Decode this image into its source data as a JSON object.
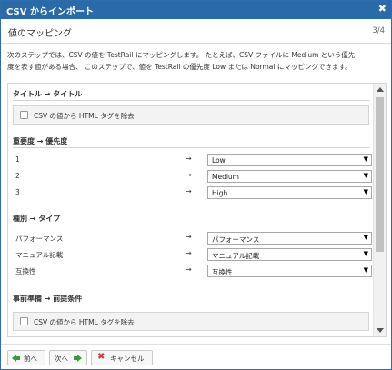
{
  "titlebar": {
    "title": "CSV からインポート",
    "close_glyph": "✖"
  },
  "header": {
    "title": "値のマッピング",
    "step": "3/4"
  },
  "intro": {
    "line1": "次のステップでは、CSV の値を TestRail にマッピングします。 たとえば、CSV ファイルに Medium という優先",
    "line2": "度を表す値がある場合、 このステップで、値を TestRail の優先度 Low または Normal にマッピングできます。"
  },
  "sections": {
    "title": {
      "heading": "タイトル → タイトル",
      "checkbox_label": "CSV の値から HTML タグを除去"
    },
    "priority": {
      "heading": "重要度 → 優先度",
      "rows": [
        {
          "key": "1",
          "arrow": "→",
          "value": "Low"
        },
        {
          "key": "2",
          "arrow": "→",
          "value": "Medium"
        },
        {
          "key": "3",
          "arrow": "→",
          "value": "High"
        }
      ]
    },
    "type": {
      "heading": "種別 → タイプ",
      "rows": [
        {
          "key": "パフォーマンス",
          "arrow": "→",
          "value": "パフォーマンス"
        },
        {
          "key": "マニュアル記載",
          "arrow": "→",
          "value": "マニュアル記載"
        },
        {
          "key": "互換性",
          "arrow": "→",
          "value": "互換性"
        }
      ]
    },
    "preconditions": {
      "heading": "事前準備 → 前提条件",
      "checkbox_label": "CSV の値から HTML タグを除去"
    }
  },
  "select_caret": "▼",
  "footer": {
    "prev_label": "前へ",
    "next_label": "次へ",
    "cancel_label": "キャンセル",
    "cancel_glyph": "✖"
  },
  "colors": {
    "titlebar": "#2b6aa8",
    "arrow_green": "#3a9a3a",
    "cancel_red": "#d43131"
  },
  "icons": {
    "prev": "arrow-left-icon",
    "next": "arrow-right-icon",
    "cancel": "close-icon"
  }
}
